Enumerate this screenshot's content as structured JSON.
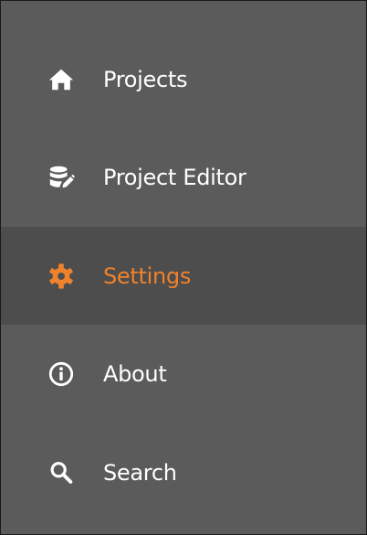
{
  "nav": {
    "items": [
      {
        "label": "Projects",
        "icon": "home-icon",
        "selected": false
      },
      {
        "label": "Project Editor",
        "icon": "database-edit-icon",
        "selected": false
      },
      {
        "label": "Settings",
        "icon": "gear-icon",
        "selected": true
      },
      {
        "label": "About",
        "icon": "info-icon",
        "selected": false
      },
      {
        "label": "Search",
        "icon": "search-icon",
        "selected": false
      }
    ]
  },
  "colors": {
    "panel_background": "#5b5b5b",
    "selected_background": "#4d4d4d",
    "text": "#ffffff",
    "accent": "#f0822d"
  }
}
